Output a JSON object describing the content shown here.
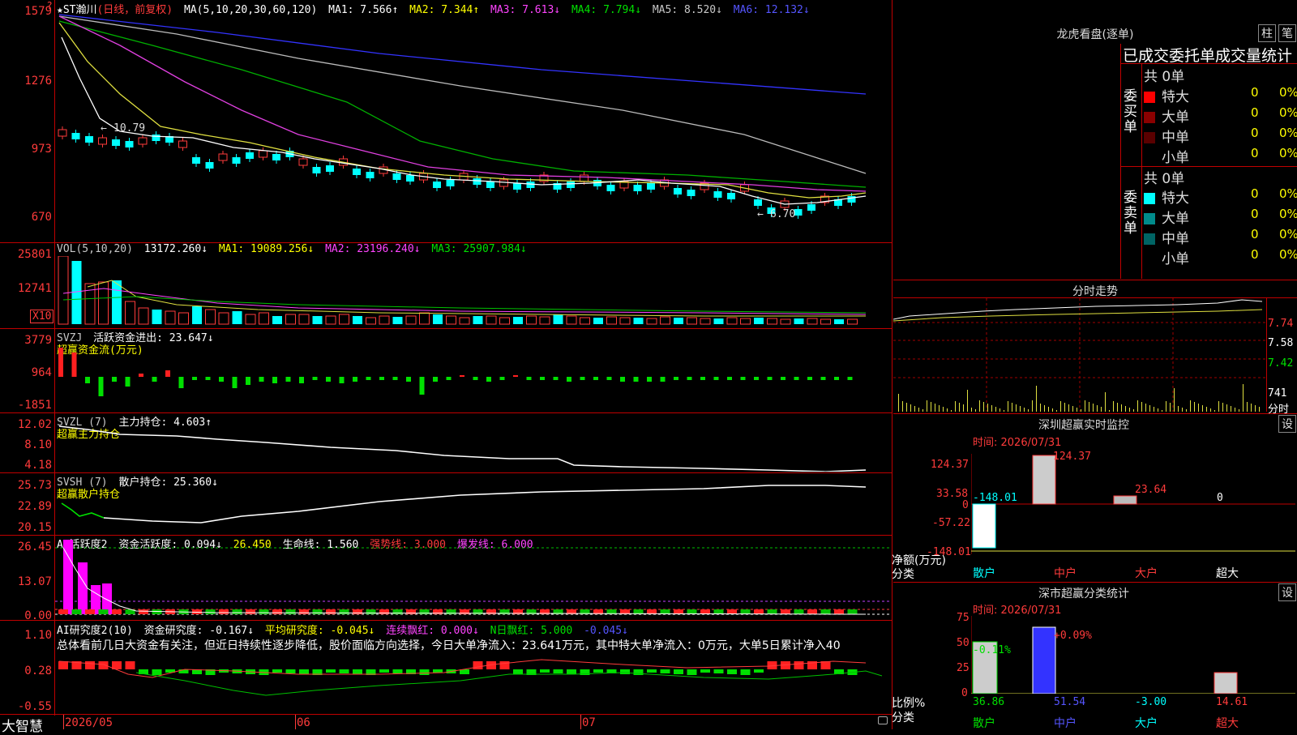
{
  "main": {
    "title_prefix": "★ST瀚川",
    "title_mode": "(日线，前复权)",
    "ma_label": "MA(5,10,20,30,60,120)",
    "ma": [
      "MA1: 7.566↑",
      "MA2: 7.344↑",
      "MA3: 7.613↓",
      "MA4: 7.794↓",
      "MA5: 8.520↓",
      "MA6: 12.132↓"
    ],
    "axis": [
      "1579",
      "1276",
      "973",
      "670"
    ],
    "high_label": "10.79",
    "low_label": "6.70"
  },
  "vol": {
    "label": "VOL(5,10,20)",
    "value": "13172.260↓",
    "ma": [
      "MA1: 19089.256↓",
      "MA2: 23196.240↓",
      "MA3: 25907.984↓"
    ],
    "axis": [
      "25801",
      "12741"
    ],
    "multiplier": "X10"
  },
  "svzj": {
    "label": "SVZJ",
    "text": "活跃资金进出: 23.647↓",
    "sub": "超赢资金流(万元)",
    "axis": [
      "3779",
      "964",
      "-1851"
    ]
  },
  "svzl": {
    "label": "SVZL (7)",
    "text": "主力持仓: 4.603↑",
    "sub": "超赢主力持仓",
    "axis": [
      "12.02",
      "8.10",
      "4.18"
    ]
  },
  "svsh": {
    "label": "SVSH (7)",
    "text": "散户持仓: 25.360↓",
    "sub": "超赢散户持仓",
    "axis": [
      "25.73",
      "22.89",
      "20.15"
    ]
  },
  "ai_active": {
    "label": "AI活跃度2",
    "text": "资金活跃度: 0.094↓",
    "v2": "26.450",
    "life": "生命线: 1.560",
    "strong": "强势线: 3.000",
    "burst": "爆发线: 6.000",
    "axis": [
      "26.45",
      "13.07",
      "0.00"
    ]
  },
  "ai_research": {
    "label": "AI研究度2(10)",
    "text": "资金研究度: -0.167↓",
    "avg": "平均研究度: -0.045↓",
    "red": "连续飘红: 0.000↓",
    "nred": "N日飘红: 5.000",
    "last": "-0.045↓",
    "summary": "总体看前几日大资金有关注，但近日持续性逐步降低，股价面临方向选择，今日大单净流入：23.641万元，其中特大单净流入：0万元，大单5日累计净入40",
    "axis": [
      "1.10",
      "0.28",
      "-0.55"
    ]
  },
  "xaxis": {
    "brand": "大智慧",
    "dates": [
      "2026/05",
      "06",
      "07"
    ]
  },
  "longhu": {
    "title": "龙虎看盘(逐单)",
    "btn1": "柱",
    "btn2": "笔",
    "header": "已成交委托单成交量统计",
    "buy": {
      "side": "委买单",
      "total": "共 0单",
      "rows": [
        {
          "name": "特大",
          "count": "0",
          "pct": "0%",
          "color": "#ff0000"
        },
        {
          "name": "大单",
          "count": "0",
          "pct": "0%",
          "color": "#8b0000"
        },
        {
          "name": "中单",
          "count": "0",
          "pct": "0%",
          "color": "#5a0000"
        },
        {
          "name": "小单",
          "count": "0",
          "pct": "0%",
          "color": "#000000"
        }
      ]
    },
    "sell": {
      "side": "委卖单",
      "total": "共 0单",
      "rows": [
        {
          "name": "特大",
          "count": "0",
          "pct": "0%",
          "color": "#00ffff"
        },
        {
          "name": "大单",
          "count": "0",
          "pct": "0%",
          "color": "#008b8b"
        },
        {
          "name": "中单",
          "count": "0",
          "pct": "0%",
          "color": "#006464"
        },
        {
          "name": "小单",
          "count": "0",
          "pct": "0%",
          "color": "#000000"
        }
      ]
    }
  },
  "intraday": {
    "title": "分时走势",
    "axis": [
      "7.74",
      "7.58",
      "7.42"
    ],
    "vol_label": "741",
    "vol_sub": "分时"
  },
  "sz_monitor": {
    "title": "深圳超赢实时监控",
    "btn": "设",
    "time": "时间: 2026/07/31",
    "axis": [
      "124.37",
      "33.58",
      "0",
      "-57.22",
      "-148.01"
    ],
    "ylabel": "净额(万元)",
    "xlabel": "分类",
    "values": [
      "-148.01",
      "124.37",
      "23.64",
      "0"
    ],
    "categories": [
      "散户",
      "中户",
      "大户",
      "超大"
    ]
  },
  "sz_class": {
    "title": "深市超赢分类统计",
    "btn": "设",
    "time": "时间: 2026/07/31",
    "axis": [
      "75",
      "50",
      "25",
      "0"
    ],
    "ylabel": "比例%",
    "xlabel": "分类",
    "top_values": [
      "-0.11%",
      "+0.09%"
    ],
    "values": [
      "36.86",
      "51.54",
      "-3.00",
      "14.61"
    ],
    "categories": [
      "散户",
      "中户",
      "大户",
      "超大"
    ]
  }
}
